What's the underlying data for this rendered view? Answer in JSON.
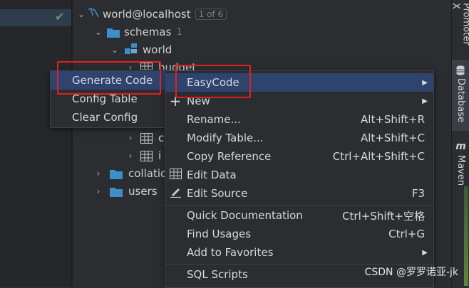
{
  "tree": {
    "connection": "world@localhost",
    "connection_badge": "1 of 6",
    "schemas_label": "schemas",
    "schemas_count": "1",
    "schema_name": "world",
    "table_partial": "budget",
    "row_t1": "c",
    "row_t2": "i",
    "collations": "collatio",
    "users": "users"
  },
  "right_tabs": {
    "promoter": "Promoter X",
    "database": "Database",
    "maven": "Maven",
    "maven_icon": "m"
  },
  "submenu": {
    "items": [
      "Generate Code",
      "Config Table",
      "Clear Config"
    ]
  },
  "context_menu": {
    "easycode": "EasyCode",
    "new": "New",
    "rename": "Rename...",
    "rename_sc": "Alt+Shift+R",
    "modify_table": "Modify Table...",
    "modify_table_sc": "Alt+Shift+C",
    "copy_reference": "Copy Reference",
    "copy_reference_sc": "Ctrl+Alt+Shift+C",
    "edit_data": "Edit Data",
    "edit_source": "Edit Source",
    "edit_source_sc": "F3",
    "quick_doc": "Quick Documentation",
    "quick_doc_sc": "Ctrl+Shift+空格",
    "find_usages": "Find Usages",
    "find_usages_sc": "Ctrl+G",
    "add_favorites": "Add to Favorites",
    "sql_scripts": "SQL Scripts"
  },
  "watermark": "CSDN @罗罗诺亚-jk",
  "colors": {
    "highlight": "#2e436e",
    "annotation_red": "#e0201f",
    "folder_blue": "#3d8fcc"
  },
  "icons": [
    "chevron-down-icon",
    "chevron-right-icon",
    "folder-icon",
    "database-icon",
    "schema-icon",
    "table-icon",
    "plus-icon",
    "grid-icon",
    "pencil-icon",
    "check-icon"
  ]
}
